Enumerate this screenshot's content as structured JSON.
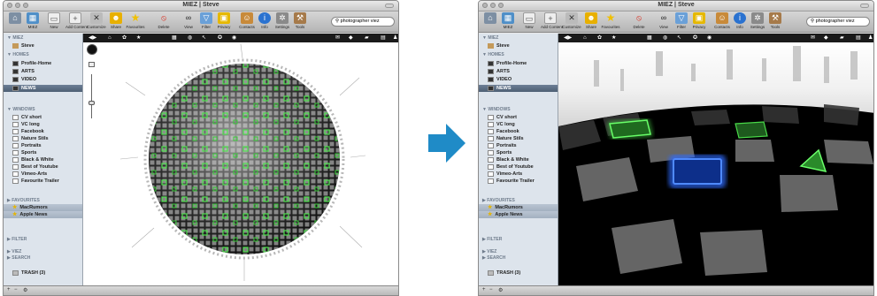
{
  "app": {
    "title": "MIEZ | Steve",
    "search_value": "photographer viez"
  },
  "toolbar": {
    "miez": "MIEZ",
    "new": "New",
    "add_content": "Add Content",
    "customize": "Customize",
    "share": "Share",
    "favourites": "Favourites",
    "delete": "Delete",
    "view": "View",
    "filter": "Filter",
    "privacy": "Privacy",
    "contacts": "Contacts",
    "info": "Info",
    "settings": "Settings",
    "tools": "Tools"
  },
  "sidebar": {
    "miez_header": "▼ MIEZ",
    "user": "Steve",
    "homes_header": "▼ HOMES",
    "homes": [
      "Profile-Home",
      "ARTS",
      "VIDEO",
      "NEWS"
    ],
    "windows_header": "▼ WINDOWS",
    "windows": [
      "CV short",
      "VC long",
      "Facebook",
      "Nature Stils",
      "Portraits",
      "Sports",
      "Black & White",
      "Best of Youtube",
      "Vimeo-Arts",
      "Favourite Trailer"
    ],
    "favourites_header": "▶ FAVOURITES",
    "favourites": [
      "MacRumors",
      "Apple News"
    ],
    "filter": "▶ FILTER",
    "viez": "▶ VIEZ",
    "search": "▶ SEARCH",
    "trash": "TRASH (3)"
  },
  "bottombar": {
    "add": "+",
    "remove": "−",
    "gear": "⚙"
  },
  "colors": {
    "accent": "#1f8bc7",
    "selection": "#56687e",
    "glow_green": "#48d848",
    "glow_blue": "#2f6bff"
  }
}
